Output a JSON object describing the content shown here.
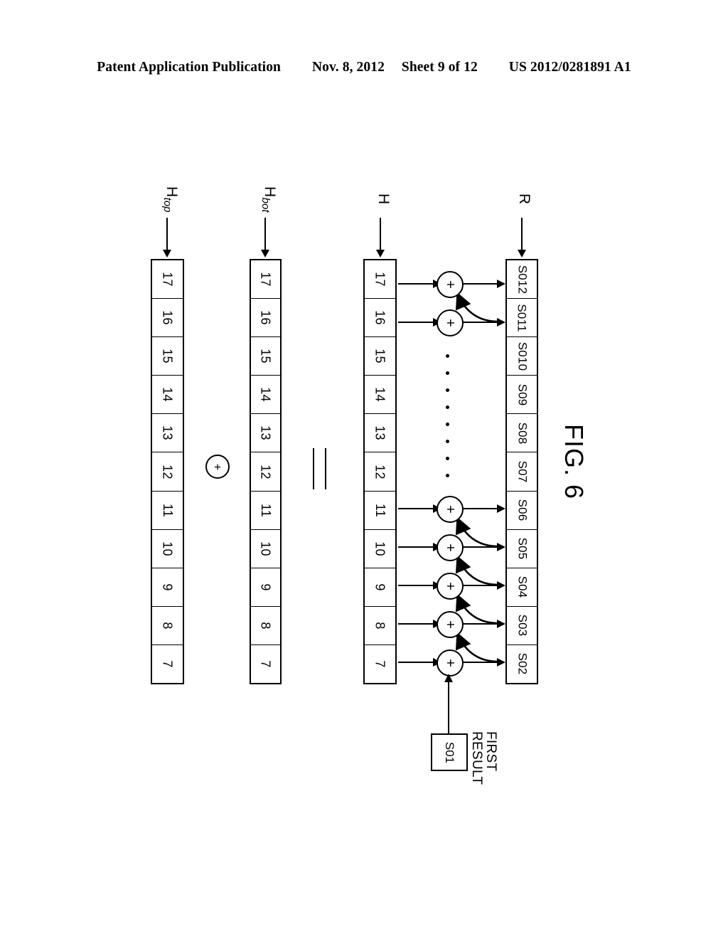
{
  "header": {
    "publication": "Patent Application Publication",
    "date": "Nov. 8, 2012",
    "sheet": "Sheet 9 of 12",
    "pub_number": "US 2012/0281891 A1"
  },
  "figure": {
    "caption": "FIG. 6",
    "arrays": [
      {
        "id": "htop",
        "label_base": "H",
        "label_sub": "top",
        "arrow_icon": "down-arrow-icon",
        "cells": [
          "17",
          "16",
          "15",
          "14",
          "13",
          "12",
          "11",
          "10",
          "9",
          "8",
          "7"
        ]
      },
      {
        "id": "hbot",
        "label_base": "H",
        "label_sub": "bot",
        "arrow_icon": "down-arrow-icon",
        "cells": [
          "17",
          "16",
          "15",
          "14",
          "13",
          "12",
          "11",
          "10",
          "9",
          "8",
          "7"
        ]
      },
      {
        "id": "h",
        "label_base": "H",
        "label_sub": "",
        "arrow_icon": "down-arrow-icon",
        "cells": [
          "17",
          "16",
          "15",
          "14",
          "13",
          "12",
          "11",
          "10",
          "9",
          "8",
          "7"
        ]
      },
      {
        "id": "r",
        "label_base": "R",
        "label_sub": "",
        "arrow_icon": "down-arrow-icon",
        "cells": [
          "S012",
          "S011",
          "S010",
          "S09",
          "S08",
          "S07",
          "S06",
          "S05",
          "S04",
          "S03",
          "S02"
        ]
      }
    ],
    "operators": {
      "plus_between_arrays": "+",
      "plus_icon": "plus-circle-icon",
      "equals_between_arrays": "=",
      "equals_icon": "equals-icon",
      "adder_symbol": "+",
      "adder_icon": "adder-circle-icon",
      "adder_count": 7
    },
    "ellipsis": {
      "icon": "vertical-ellipsis-icon",
      "dot_count": 8
    },
    "first_result": {
      "box_label": "S01",
      "caption_line1": "FIRST",
      "caption_line2": "RESULT",
      "feed_arrow_icon": "up-arrow-icon"
    },
    "colors": {
      "ink": "#000000",
      "paper": "#ffffff"
    }
  }
}
